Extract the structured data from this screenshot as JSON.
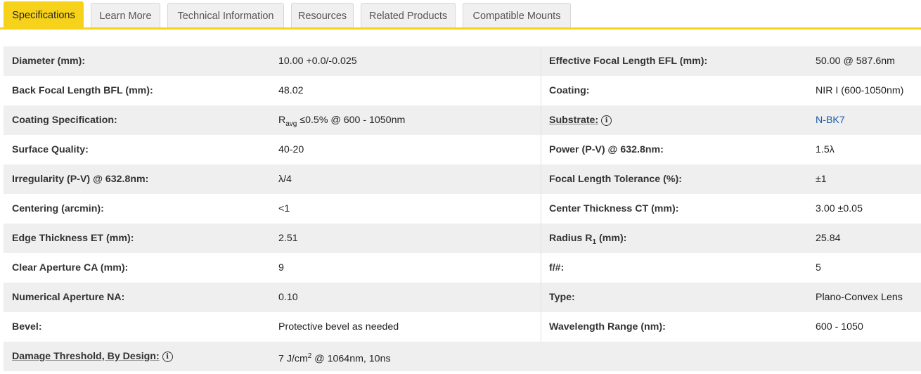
{
  "tabs": [
    {
      "label": "Specifications",
      "active": true
    },
    {
      "label": "Learn More"
    },
    {
      "label": "Technical Information"
    },
    {
      "label": "Resources"
    },
    {
      "label": "Related Products"
    },
    {
      "label": "Compatible Mounts"
    }
  ],
  "specs": {
    "diameter": {
      "label": "Diameter (mm):",
      "value": "10.00 +0.0/-0.025"
    },
    "efl": {
      "label": "Effective Focal Length EFL (mm):",
      "value": "50.00 @ 587.6nm"
    },
    "bfl": {
      "label": "Back Focal Length BFL (mm):",
      "value": "48.02"
    },
    "coating": {
      "label": "Coating:",
      "value": "NIR I (600-1050nm)"
    },
    "coating_spec": {
      "label": "Coating Specification:",
      "value_r": "R",
      "value_sub": "avg",
      "value_rest": " ≤0.5% @ 600 - 1050nm"
    },
    "substrate": {
      "label": "Substrate:",
      "value": "N-BK7"
    },
    "surface_quality": {
      "label": "Surface Quality:",
      "value": "40-20"
    },
    "power": {
      "label": "Power (P-V) @ 632.8nm:",
      "value": "1.5λ"
    },
    "irregularity": {
      "label": "Irregularity (P-V) @ 632.8nm:",
      "value": "λ/4"
    },
    "focal_tol": {
      "label": "Focal Length Tolerance (%):",
      "value": "±1"
    },
    "centering": {
      "label": "Centering (arcmin):",
      "value": "<1"
    },
    "center_thickness": {
      "label": "Center Thickness CT (mm):",
      "value": "3.00 ±0.05"
    },
    "edge_thickness": {
      "label": "Edge Thickness ET (mm):",
      "value": "2.51"
    },
    "radius": {
      "label_pre": "Radius R",
      "label_sub": "1",
      "label_post": " (mm):",
      "value": "25.84"
    },
    "clear_aperture": {
      "label": "Clear Aperture CA (mm):",
      "value": "9"
    },
    "fnum": {
      "label": "f/#:",
      "value": "5"
    },
    "na": {
      "label": "Numerical Aperture NA:",
      "value": "0.10"
    },
    "type": {
      "label": "Type:",
      "value": "Plano-Convex Lens"
    },
    "bevel": {
      "label": "Bevel:",
      "value": "Protective bevel as needed"
    },
    "wavelength": {
      "label": "Wavelength Range (nm):",
      "value": "600 - 1050"
    },
    "damage": {
      "label": "Damage Threshold, By Design:",
      "value_pre": "7 J/cm",
      "value_sup": "2",
      "value_post": " @ 1064nm, 10ns"
    }
  },
  "icons": {
    "info": "i"
  },
  "colors": {
    "accent": "#f7d21a",
    "link": "#1a5ba8",
    "row_shade": "#efefef"
  }
}
